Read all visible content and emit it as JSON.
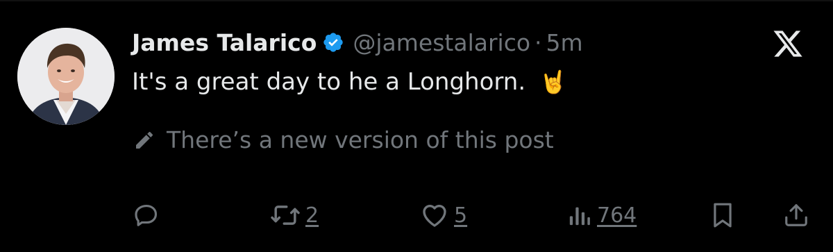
{
  "tweet": {
    "author": {
      "display_name": "James Talarico",
      "verified": true,
      "handle": "@jamestalarico",
      "avatar": "profile-photo"
    },
    "separator": "·",
    "timestamp": "5m",
    "text": "It's a great day to he a Longhorn.",
    "emoji": "🤘",
    "edit_notice": "There’s a new version of this post",
    "brand_icon": "x-logo",
    "actions": {
      "reply": {
        "icon": "reply-icon",
        "count": ""
      },
      "repost": {
        "icon": "repost-icon",
        "count": "2"
      },
      "like": {
        "icon": "heart-icon",
        "count": "5"
      },
      "views": {
        "icon": "views-icon",
        "count": "764"
      },
      "bookmark": {
        "icon": "bookmark-icon"
      },
      "share": {
        "icon": "share-icon"
      }
    }
  },
  "colors": {
    "background": "#000000",
    "primary_text": "#e7e9ea",
    "secondary_text": "#71767b",
    "verified_blue": "#1d9bf0"
  }
}
